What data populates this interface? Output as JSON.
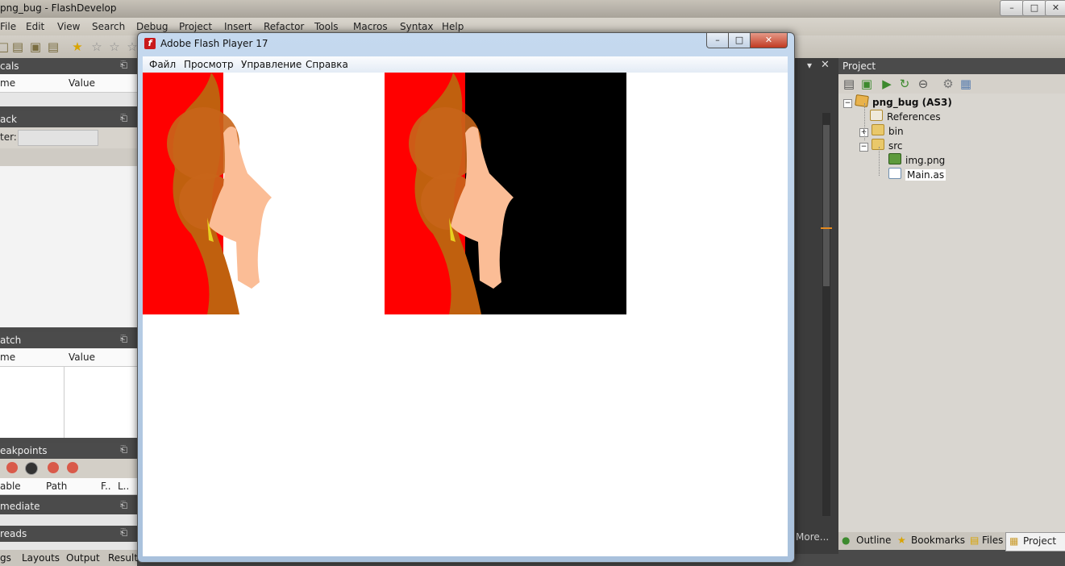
{
  "ide": {
    "title": "png_bug - FlashDevelop",
    "window_controls": [
      "–",
      "□",
      "✕"
    ],
    "menu": [
      "File",
      "Edit",
      "View",
      "Search",
      "Debug",
      "Project",
      "Insert",
      "Refactor",
      "Tools",
      "Macros",
      "Syntax",
      "Help"
    ],
    "left_panels": {
      "locals": {
        "title": "cals",
        "col_name": "me",
        "col_value": "Value"
      },
      "stack": {
        "title": "ack",
        "filter_label": "ter:"
      },
      "watch": {
        "title": "atch",
        "col_name": "me",
        "col_value": "Value"
      },
      "breakpoints": {
        "title": "eakpoints",
        "cols": [
          "able",
          "Path",
          "F..",
          "L.."
        ]
      },
      "immediate": {
        "title": "mediate"
      },
      "threads": {
        "title": "reads"
      }
    },
    "bottom_tabs_left": [
      "gs",
      "Layouts",
      "Output",
      "Results"
    ],
    "more_label": "More...",
    "project_panel": {
      "title": "Project",
      "tree": [
        {
          "label": "png_bug (AS3)",
          "icon": "project-icon",
          "bold": true
        },
        {
          "label": "References",
          "icon": "folder-icon"
        },
        {
          "label": "bin",
          "icon": "folder-icon"
        },
        {
          "label": "src",
          "icon": "folder-open-icon"
        },
        {
          "label": "img.png",
          "icon": "image-file-icon"
        },
        {
          "label": "Main.as",
          "icon": "as-file-icon",
          "selected": true
        }
      ],
      "tabs": [
        "Outline",
        "Bookmarks",
        "Files",
        "Project"
      ],
      "active_tab": "Project"
    }
  },
  "flash_player": {
    "title": "Adobe Flash Player 17",
    "logo_glyph": "f",
    "menu": [
      "Файл",
      "Просмотр",
      "Управление",
      "Справка"
    ],
    "colors": {
      "red": "#ff0000",
      "hair": "#c0600e",
      "skin": "#fbbd96",
      "black": "#000000",
      "white": "#ffffff"
    }
  }
}
